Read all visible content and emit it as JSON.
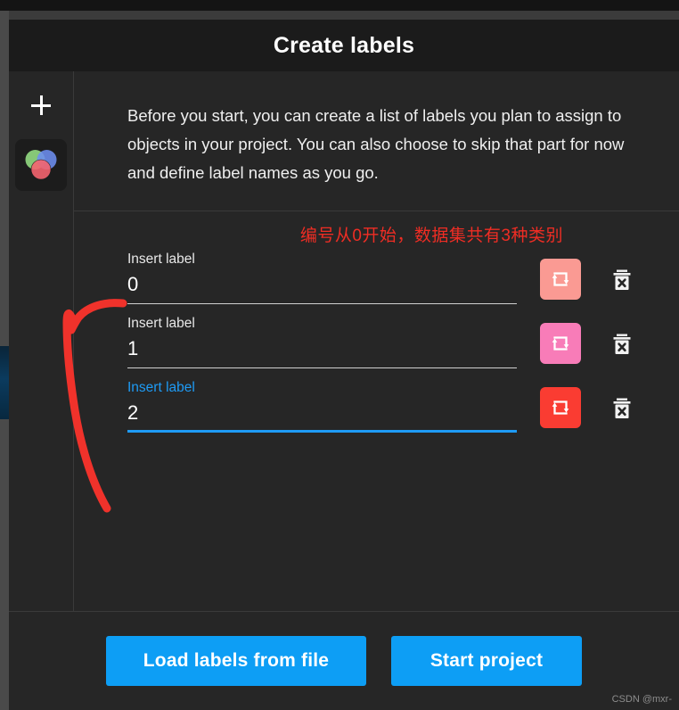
{
  "window": {
    "watermark": "CSDN @mxr-"
  },
  "modal": {
    "title": "Create labels",
    "description": "Before you start, you can create a list of labels you plan to assign to objects in your project. You can also choose to skip that part for now and define label names as you go.",
    "annotation_note": "编号从0开始，数据集共有3种类别"
  },
  "sidebar": {
    "add_icon": "plus-icon",
    "project_icon": "venn-circles-logo"
  },
  "labels": [
    {
      "caption": "Insert label",
      "value": "0",
      "color": "#fa9a93",
      "focused": false,
      "change_color_icon": "refresh-icon",
      "delete_icon": "trash-icon"
    },
    {
      "caption": "Insert label",
      "value": "1",
      "color": "#f87cb8",
      "focused": false,
      "change_color_icon": "refresh-icon",
      "delete_icon": "trash-icon"
    },
    {
      "caption": "Insert label",
      "value": "2",
      "color": "#fa3c32",
      "focused": true,
      "change_color_icon": "refresh-icon",
      "delete_icon": "trash-icon"
    }
  ],
  "footer": {
    "load_labels_label": "Load labels from file",
    "start_project_label": "Start project"
  },
  "colors": {
    "accent": "#0d9ef5",
    "annotation_red": "#ef2d24",
    "modal_bg": "#262626",
    "header_bg": "#1b1b1b"
  }
}
